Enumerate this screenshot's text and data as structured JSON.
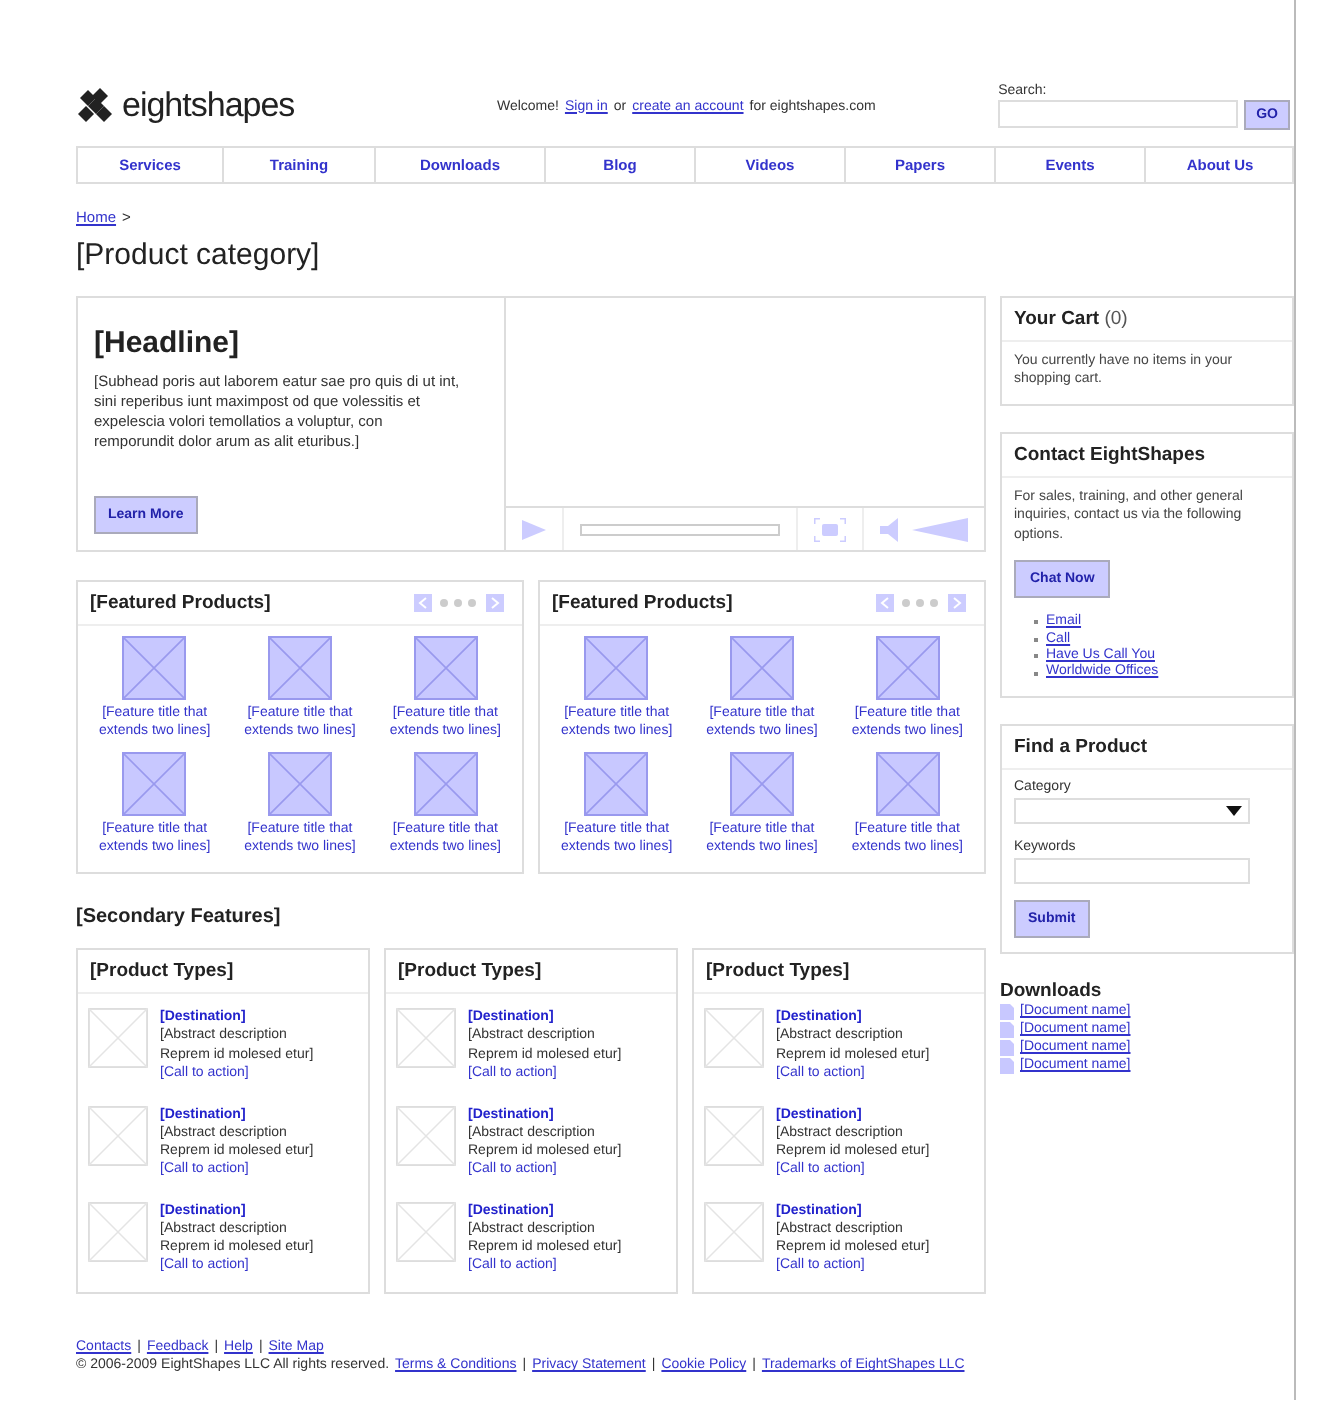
{
  "header": {
    "logo": "eightshapes",
    "welcome": [
      {
        "kind": "text",
        "text": "Welcome!"
      },
      {
        "kind": "link",
        "text": "Sign in"
      },
      {
        "kind": "text",
        "text": "or"
      },
      {
        "kind": "link",
        "text": "create an account"
      },
      {
        "kind": "text",
        "text": "for eightshapes.com"
      }
    ],
    "search": {
      "label": "Search:",
      "button": "GO"
    }
  },
  "nav": [
    "Services",
    "Training",
    "Downloads",
    "Blog",
    "Videos",
    "Papers",
    "Events",
    "About Us"
  ],
  "breadcrumb": [
    {
      "kind": "link",
      "text": "Home"
    },
    {
      "kind": "text",
      "text": ">"
    }
  ],
  "page_title": "[Product category]",
  "hero": {
    "headline": "[Headline]",
    "subhead": "[Subhead poris aut laborem eatur sae pro quis di ut int, sini reperibus iunt maximpost od que volessitis et expelescia volori temollatios a voluptur, con remporundit dolor arum as alit eturibus.]",
    "button": "Learn More"
  },
  "featured": [
    {
      "title": "[Featured Products]",
      "items": [
        "[Feature title that extends two lines]",
        "[Feature title that extends two lines]",
        "[Feature title that extends two lines]",
        "[Feature title that extends two lines]",
        "[Feature title that extends two lines]",
        "[Feature title that extends two lines]"
      ]
    },
    {
      "title": "[Featured Products]",
      "items": [
        "[Feature title that extends two lines]",
        "[Feature title that extends two lines]",
        "[Feature title that extends two lines]",
        "[Feature title that extends two lines]",
        "[Feature title that extends two lines]",
        "[Feature title that extends two lines]"
      ]
    }
  ],
  "secondary": {
    "title": "[Secondary Features]",
    "panels": [
      {
        "title": "[Product Types]",
        "items": [
          {
            "destination": "[Destination]",
            "description": "[Abstract description Reprem id molesed etur]",
            "cta": "[Call to action]"
          },
          {
            "destination": "[Destination]",
            "description": "[Abstract description Reprem id molesed etur]",
            "cta": "[Call to action]"
          },
          {
            "destination": "[Destination]",
            "description": "[Abstract description Reprem id molesed etur]",
            "cta": "[Call to action]"
          }
        ]
      },
      {
        "title": "[Product Types]",
        "items": [
          {
            "destination": "[Destination]",
            "description": "[Abstract description Reprem id molesed etur]",
            "cta": "[Call to action]"
          },
          {
            "destination": "[Destination]",
            "description": "[Abstract description Reprem id molesed etur]",
            "cta": "[Call to action]"
          },
          {
            "destination": "[Destination]",
            "description": "[Abstract description Reprem id molesed etur]",
            "cta": "[Call to action]"
          }
        ]
      },
      {
        "title": "[Product Types]",
        "items": [
          {
            "destination": "[Destination]",
            "description": "[Abstract description Reprem id molesed etur]",
            "cta": "[Call to action]"
          },
          {
            "destination": "[Destination]",
            "description": "[Abstract description Reprem id molesed etur]",
            "cta": "[Call to action]"
          },
          {
            "destination": "[Destination]",
            "description": "[Abstract description Reprem id molesed etur]",
            "cta": "[Call to action]"
          }
        ]
      }
    ]
  },
  "sidebar": {
    "cart": {
      "title": "Your Cart",
      "count": "(0)",
      "text": "You currently have no items in your shopping cart."
    },
    "contact": {
      "title": "Contact EightShapes",
      "text": "For sales, training, and other general inquiries, contact us via the following options.",
      "button": "Chat Now",
      "links": [
        "Email",
        "Call",
        "Have Us Call You",
        "Worldwide Offices"
      ]
    },
    "find": {
      "title": "Find a Product",
      "category_label": "Category",
      "keywords_label": "Keywords",
      "button": "Submit"
    },
    "downloads": {
      "title": "Downloads",
      "documents": [
        "[Document name]",
        "[Document name]",
        "[Document name]",
        "[Document name]"
      ]
    }
  },
  "footer": {
    "links": [
      {
        "kind": "link",
        "text": "Contacts"
      },
      {
        "kind": "text",
        "text": "|"
      },
      {
        "kind": "link",
        "text": "Feedback"
      },
      {
        "kind": "text",
        "text": "|"
      },
      {
        "kind": "link",
        "text": "Help"
      },
      {
        "kind": "text",
        "text": "|"
      },
      {
        "kind": "link",
        "text": "Site Map"
      }
    ],
    "legal": [
      {
        "kind": "text",
        "text": "© 2006-2009 EightShapes LLC All rights reserved."
      },
      {
        "kind": "link",
        "text": "Terms & Conditions"
      },
      {
        "kind": "text",
        "text": "|"
      },
      {
        "kind": "link",
        "text": "Privacy Statement"
      },
      {
        "kind": "text",
        "text": "|"
      },
      {
        "kind": "link",
        "text": "Cookie Policy"
      },
      {
        "kind": "text",
        "text": "|"
      },
      {
        "kind": "link",
        "text": "Trademarks of EightShapes LLC"
      }
    ]
  }
}
